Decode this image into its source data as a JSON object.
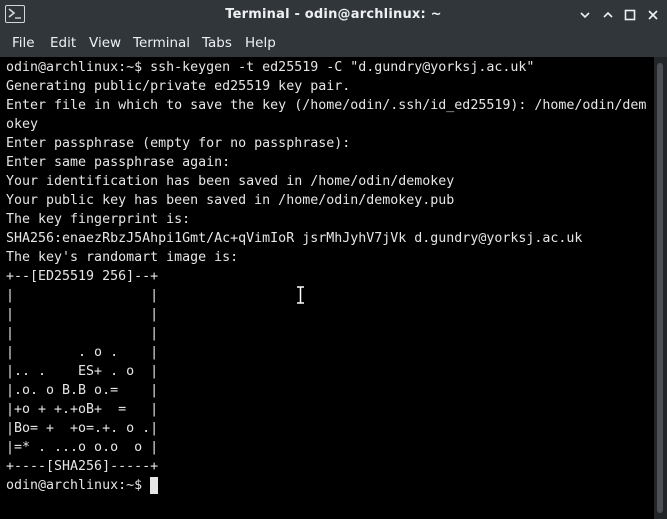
{
  "window": {
    "title": "Terminal - odin@archlinux: ~",
    "icon": "terminal-icon",
    "controls": [
      "minimize-icon",
      "maximize-icon",
      "close-icon"
    ]
  },
  "menu": [
    "File",
    "Edit",
    "View",
    "Terminal",
    "Tabs",
    "Help"
  ],
  "terminal": {
    "lines": [
      "odin@archlinux:~$ ssh-keygen -t ed25519 -C \"d.gundry@yorksj.ac.uk\"",
      "Generating public/private ed25519 key pair.",
      "Enter file in which to save the key (/home/odin/.ssh/id_ed25519): /home/odin/dem",
      "okey",
      "Enter passphrase (empty for no passphrase):",
      "Enter same passphrase again:",
      "Your identification has been saved in /home/odin/demokey",
      "Your public key has been saved in /home/odin/demokey.pub",
      "The key fingerprint is:",
      "SHA256:enaezRbzJ5Ahpi1Gmt/Ac+qVimIoR jsrMhJyhV7jVk d.gundry@yorksj.ac.uk",
      "The key's randomart image is:",
      "+--[ED25519 256]--+",
      "|                 |",
      "|                 |",
      "|                 |",
      "|        . o .    |",
      "|.. .    ES+ . o  |",
      "|.o. o B.B o.=    |",
      "|+o + +.+oB+  =   |",
      "|Bo= +  +o=.+. o .|",
      "|=* . ...o o.o  o |",
      "+----[SHA256]-----+"
    ],
    "prompt": "odin@archlinux:~$ "
  },
  "colors": {
    "titlebar": "#31363b",
    "terminal_bg": "#000000",
    "terminal_fg": "#e6e6e6"
  }
}
